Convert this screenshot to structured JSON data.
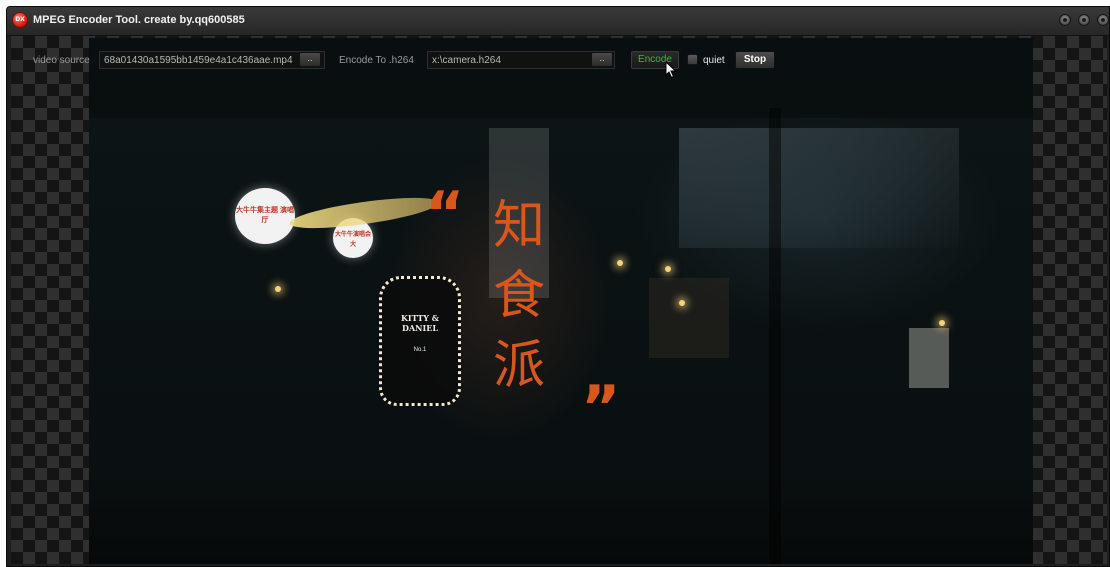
{
  "window": {
    "title": "MPEG Encoder Tool. create by.qq600585",
    "app_icon_text": "DX"
  },
  "toolbar": {
    "video_source_label": "video source",
    "video_source_value": "68a01430a1595bb1459e4a1c436aae.mp4",
    "browse_source_label": "..",
    "encode_to_label": "Encode To .h264",
    "encode_to_value": "x:\\camera.h264",
    "browse_target_label": "..",
    "encode_button": "Encode",
    "quiet_label": "quiet",
    "quiet_checked": false,
    "stop_button": "Stop"
  },
  "video": {
    "vertical_chars": [
      "知",
      "食",
      "派"
    ],
    "quote_open": "“",
    "quote_close": "”",
    "sign_brand": "KITTY & DANIEL",
    "sign_no": "No.1",
    "bubble_large": "大牛牛集主题 演唱厅",
    "bubble_small": "大牛牛演唱会大"
  },
  "colors": {
    "accent_orange": "#d9561d",
    "encode_green": "#2fbf2f"
  }
}
